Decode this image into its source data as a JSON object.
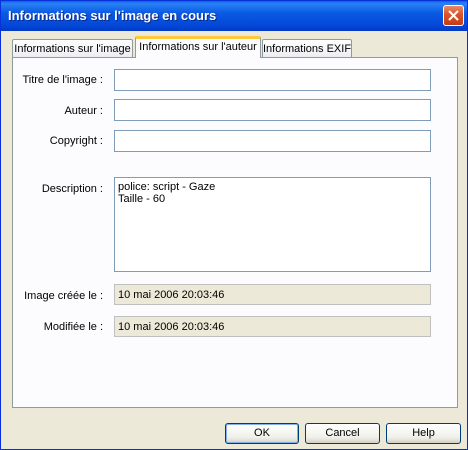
{
  "window": {
    "title": "Informations sur l'image en cours"
  },
  "tabs": [
    {
      "label": "Informations sur l'image",
      "active": false
    },
    {
      "label": "Informations sur l'auteur",
      "active": true
    },
    {
      "label": "Informations EXIF",
      "active": false
    }
  ],
  "form": {
    "title_label": "Titre de l'image :",
    "title_value": "",
    "author_label": "Auteur :",
    "author_value": "",
    "copyright_label": "Copyright :",
    "copyright_value": "",
    "description_label": "Description :",
    "description_lines": [
      "police: script - Gaze",
      "Taille - 60"
    ],
    "created_label": "Image créée le :",
    "created_value": "10 mai 2006 20:03:46",
    "modified_label": "Modifiée le :",
    "modified_value": "10 mai 2006 20:03:46"
  },
  "buttons": {
    "ok": "OK",
    "cancel": "Cancel",
    "help": "Help"
  },
  "icons": {
    "close": "close-icon"
  },
  "colors": {
    "titlebar": "#0a5ae4",
    "active_tab_accent": "#ffc73c",
    "window_bg": "#ece9d8"
  }
}
